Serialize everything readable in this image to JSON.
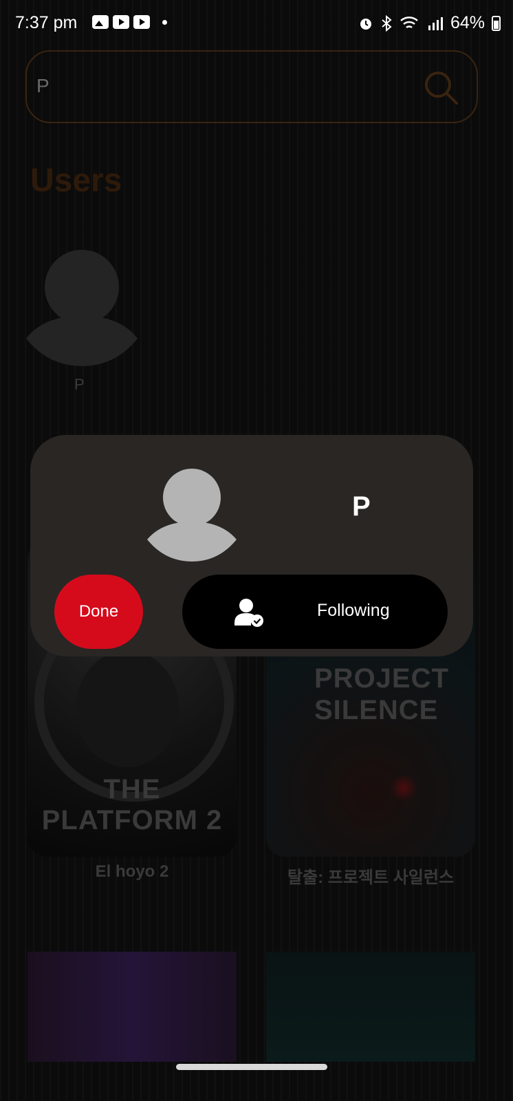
{
  "status_bar": {
    "time": "7:37 pm",
    "battery": "64%"
  },
  "search": {
    "value": "P"
  },
  "users_section": {
    "title": "Users",
    "user": {
      "name": "P"
    }
  },
  "movies": [
    {
      "poster_text": "THE PLATFORM 2",
      "title": "El hoyo 2"
    },
    {
      "poster_text": "PROJECT SILENCE",
      "title": "탈출: 프로젝트 사일런스"
    }
  ],
  "modal": {
    "name": "P",
    "done_label": "Done",
    "following_label": "Following",
    "accent_color": "#d50b1c"
  }
}
